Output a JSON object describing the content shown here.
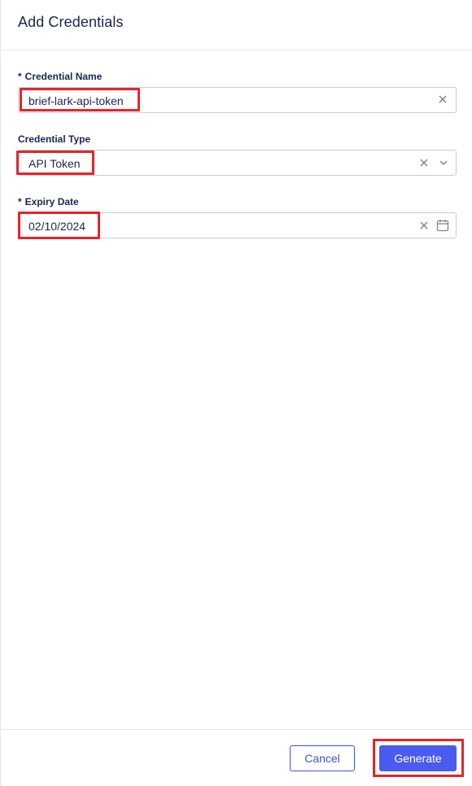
{
  "header": {
    "title": "Add Credentials"
  },
  "form": {
    "credential_name": {
      "required_marker": "*",
      "label": "Credential Name",
      "value": "brief-lark-api-token"
    },
    "credential_type": {
      "label": "Credential Type",
      "value": "API Token"
    },
    "expiry_date": {
      "required_marker": "*",
      "label": "Expiry Date",
      "value": "02/10/2024"
    }
  },
  "footer": {
    "cancel_label": "Cancel",
    "generate_label": "Generate"
  },
  "colors": {
    "primary": "#4a5bf0",
    "highlight": "#e8232a",
    "text": "#1c2550"
  }
}
